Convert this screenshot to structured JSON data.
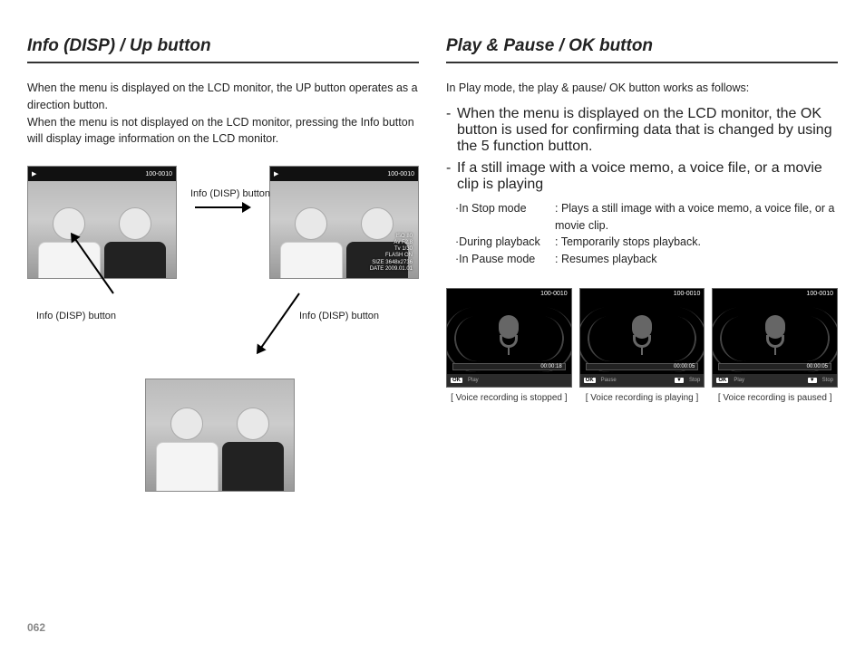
{
  "left": {
    "heading": "Info (DISP) / Up button",
    "para": "When the menu is displayed on the LCD monitor, the UP button operates as a direction button.\nWhen the menu is not displayed on the LCD monitor, pressing the Info button will display image information on the LCD monitor.",
    "thumb_top_counter": "100-0010",
    "overlay_info": "ISO 80\nAv F2.8\nTv 1/30\nFLASH ON\nSIZE 3648x2736\nDATE 2009.01.01",
    "arrow_labels": {
      "right": "Info (DISP) button",
      "left": "Info (DISP) button",
      "bottom": "Info (DISP) button"
    }
  },
  "right": {
    "heading": "Play & Pause / OK button",
    "intro": "In Play mode, the play & pause/ OK button works as follows:",
    "bullets": [
      "When the menu is displayed on the LCD monitor, the OK button is used for confirming data that is changed by using the 5 function button.",
      "If a still image with a voice memo, a voice file, or a movie clip is playing"
    ],
    "modes": [
      {
        "label": "·In Stop mode",
        "desc": ": Plays a still image with a voice memo, a voice file, or a movie clip."
      },
      {
        "label": "·During playback",
        "desc": ": Temporarily stops playback."
      },
      {
        "label": "·In Pause mode",
        "desc": ": Resumes playback"
      }
    ],
    "screens": [
      {
        "counter": "100-0010",
        "time": "00:00:18",
        "controls": [
          {
            "badge": "OK",
            "label": "Play"
          }
        ],
        "caption": "[ Voice recording is stopped ]"
      },
      {
        "counter": "100-0010",
        "time": "00:00:05",
        "controls": [
          {
            "badge": "OK",
            "label": "Pause"
          },
          {
            "badge": "▼",
            "label": "Stop"
          }
        ],
        "caption": "[ Voice recording is playing ]"
      },
      {
        "counter": "100-0010",
        "time": "00:00:05",
        "controls": [
          {
            "badge": "OK",
            "label": "Play"
          },
          {
            "badge": "▼",
            "label": "Stop"
          }
        ],
        "caption": "[ Voice recording is paused ]"
      }
    ]
  },
  "page_number": "062"
}
